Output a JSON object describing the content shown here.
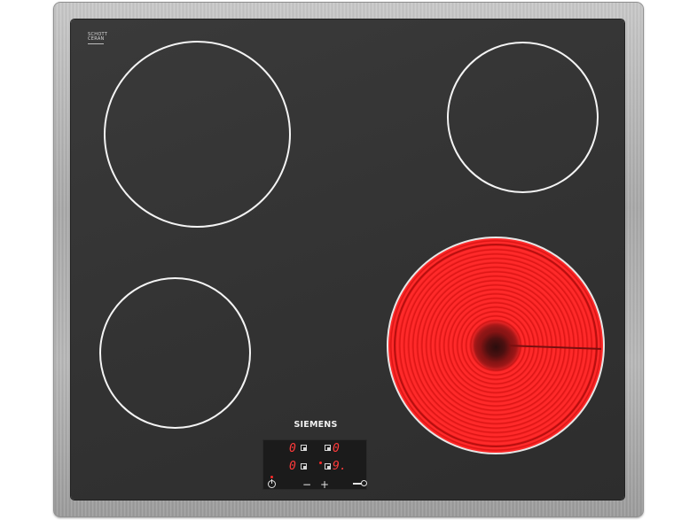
{
  "appliance": {
    "brand_label": "SIEMENS",
    "glass_badge": {
      "line1": "SCHOTT",
      "line2": "CERAN"
    },
    "cooking_zones": [
      {
        "position": "top-left",
        "state": "off"
      },
      {
        "position": "top-right",
        "state": "off"
      },
      {
        "position": "bottom-left",
        "state": "off"
      },
      {
        "position": "bottom-right",
        "state": "on-glowing"
      }
    ],
    "control_panel": {
      "displays": {
        "top_left": "0",
        "top_right": "0",
        "bottom_left": "0",
        "bottom_right": "9."
      },
      "buttons": {
        "power_icon": "power-icon",
        "minus_label": "−",
        "plus_label": "+",
        "lock_icon": "key-lock-icon"
      }
    },
    "colors": {
      "glass": "#333333",
      "frame": "#b3b3b3",
      "zone_outline": "#f4f4f4",
      "heating_red": "#ff2a2a",
      "display_red": "#ff3a3a"
    }
  }
}
